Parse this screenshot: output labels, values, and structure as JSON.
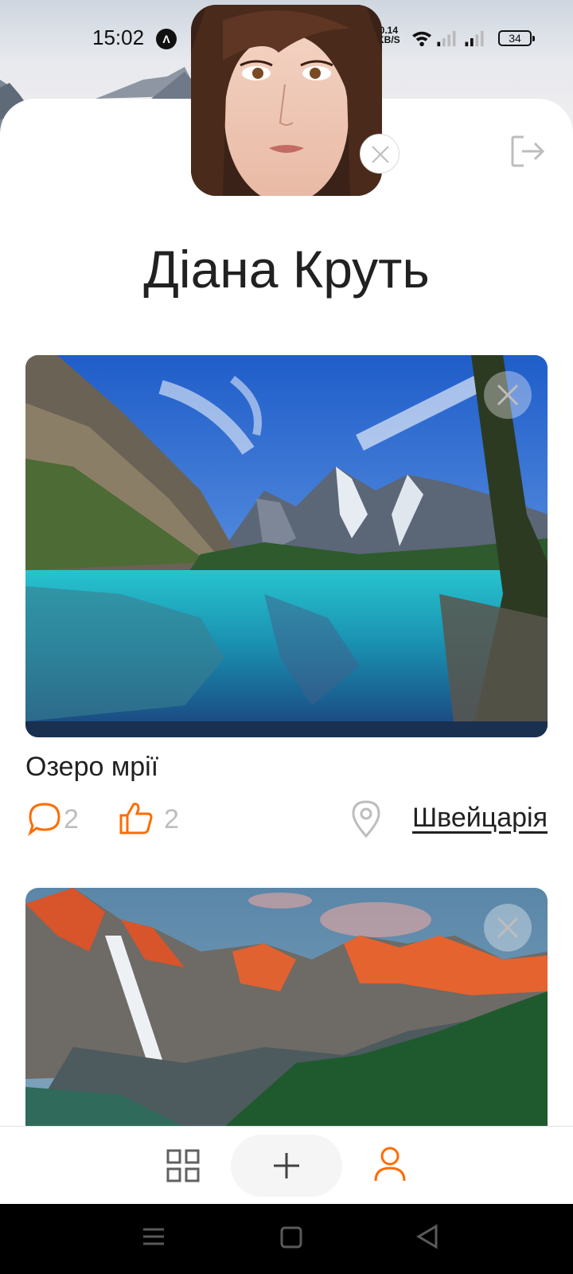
{
  "status_bar": {
    "time": "15:02",
    "app_icon_glyph": "Λ",
    "net_speed_value": "0.14",
    "net_speed_unit": "KB/S",
    "battery": "34"
  },
  "profile": {
    "name": "Діана Круть"
  },
  "posts": [
    {
      "title": "Озеро мрії",
      "comments": "2",
      "likes": "2",
      "location": "Швейцарія"
    },
    {
      "title": "",
      "comments": "",
      "likes": "",
      "location": ""
    }
  ],
  "colors": {
    "accent": "#FF6C00",
    "text": "#212121",
    "muted": "#BDBDBD"
  },
  "icons": {
    "logout": "logout-icon",
    "comment": "comment-icon",
    "like": "thumb-up-icon",
    "location": "map-pin-icon",
    "grid": "grid-icon",
    "add": "plus-icon",
    "user": "user-icon"
  }
}
